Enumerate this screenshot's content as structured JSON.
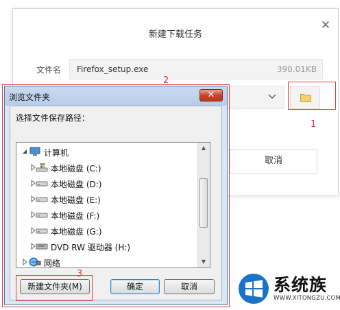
{
  "download_dialog": {
    "title": "新建下载任务",
    "file_label": "文件名",
    "file_name": "Firefox_setup.exe",
    "file_size": "390.01KB",
    "cancel_label": "取消"
  },
  "annotations": {
    "n1": "1",
    "n2": "2",
    "n3": "3",
    "color": "#e53935"
  },
  "browse_dialog": {
    "title": "浏览文件夹",
    "prompt": "选择文件保存路径：",
    "tree": [
      {
        "label": "计算机",
        "icon": "computer-icon",
        "expanded": true
      },
      {
        "label": "本地磁盘 (C:)",
        "icon": "windows-drive-icon"
      },
      {
        "label": "本地磁盘 (D:)",
        "icon": "drive-icon"
      },
      {
        "label": "本地磁盘 (E:)",
        "icon": "drive-icon"
      },
      {
        "label": "本地磁盘 (F:)",
        "icon": "drive-icon"
      },
      {
        "label": "本地磁盘 (G:)",
        "icon": "drive-icon"
      },
      {
        "label": "DVD RW 驱动器 (H:)",
        "icon": "dvd-drive-icon"
      },
      {
        "label": "网络",
        "icon": "network-icon"
      }
    ],
    "new_folder_label": "新建文件夹(M)",
    "ok_label": "确定",
    "cancel_label": "取消"
  },
  "watermark": {
    "brand": "系统族",
    "url": "WWW.XITONGZU.COM"
  }
}
